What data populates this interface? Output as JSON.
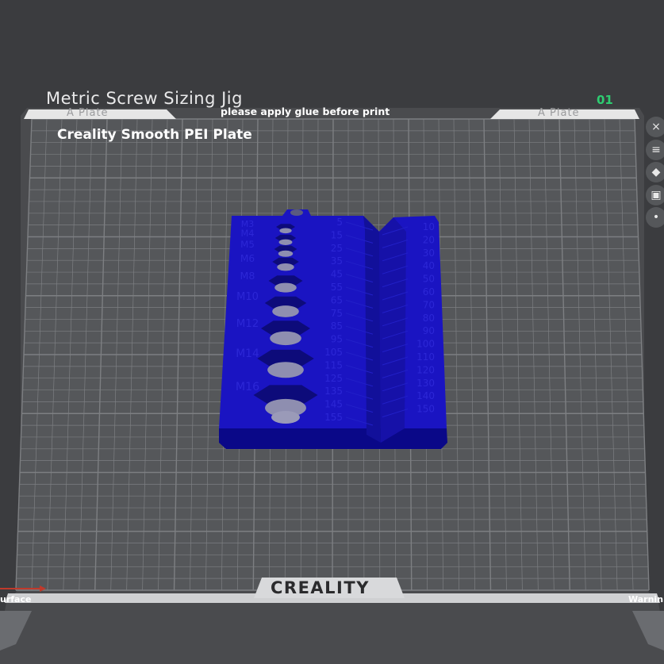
{
  "plate": {
    "name": "Metric Screw Sizing Jig",
    "index": "01",
    "note": "please apply glue before print",
    "type": "Creality Smooth PEI Plate",
    "tab_left": "A Plate",
    "tab_right": "A Plate",
    "brand": "CREALITY"
  },
  "labels": {
    "left": "urface",
    "right": "Warnin"
  },
  "colors": {
    "background": "#3b3c3f",
    "bed": "#55575a",
    "grid_line": "#7d7f82",
    "model": "#1a14c2",
    "note_green": "#2ecc71"
  },
  "model": {
    "metric_labels": [
      "M3",
      "M4",
      "M5",
      "M6",
      "M8",
      "M10",
      "M12",
      "M14",
      "M16"
    ],
    "left_lengths": [
      "5",
      "15",
      "25",
      "35",
      "45",
      "55",
      "65",
      "75",
      "85",
      "95",
      "105",
      "115",
      "125",
      "135",
      "145",
      "155"
    ],
    "right_lengths": [
      "10",
      "20",
      "30",
      "40",
      "50",
      "60",
      "70",
      "80",
      "90",
      "100",
      "110",
      "120",
      "130",
      "140",
      "150"
    ]
  },
  "side_tools": [
    {
      "icon": "close-icon",
      "glyph": "×"
    },
    {
      "icon": "list-icon",
      "glyph": "≡"
    },
    {
      "icon": "paint-icon",
      "glyph": "◆"
    },
    {
      "icon": "lock-icon",
      "glyph": "▣"
    },
    {
      "icon": "more-icon",
      "glyph": "•"
    }
  ]
}
